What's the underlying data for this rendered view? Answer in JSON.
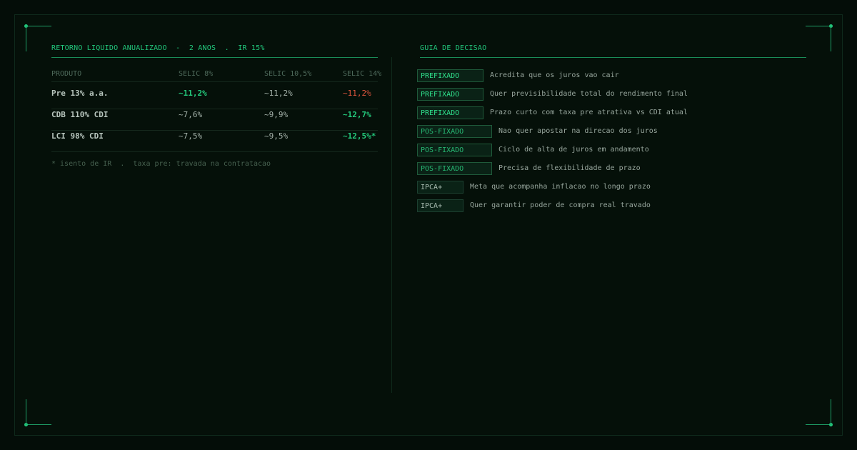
{
  "left_panel": {
    "title": "RETORNO LIQUIDO ANUALIZADO  -  2 ANOS  .  IR 15%",
    "columns": [
      "PRODUTO",
      "SELIC 8%",
      "SELIC 10,5%",
      "SELIC 14%"
    ],
    "rows": [
      {
        "product": "Pre 13% a.a.",
        "values": [
          "~11,2%",
          "~11,2%",
          "~11,2%"
        ],
        "status": [
          "best",
          "neutral",
          "worst"
        ]
      },
      {
        "product": "CDB 110% CDI",
        "values": [
          "~7,6%",
          "~9,9%",
          "~12,7%"
        ],
        "status": [
          "neutral",
          "neutral",
          "best"
        ]
      },
      {
        "product": "LCI 98% CDI",
        "values": [
          "~7,5%",
          "~9,5%",
          "~12,5%*"
        ],
        "status": [
          "neutral",
          "neutral",
          "best"
        ]
      }
    ],
    "footnote": "* isento de IR  .  taxa pre: travada na contratacao"
  },
  "right_panel": {
    "title": "GUIA DE DECISAO",
    "items": [
      {
        "tag": "PREFIXADO",
        "kind": "pre",
        "text": "Acredita que os juros vao cair"
      },
      {
        "tag": "PREFIXADO",
        "kind": "pre",
        "text": "Quer previsibilidade total do rendimento final"
      },
      {
        "tag": "PREFIXADO",
        "kind": "pre",
        "text": "Prazo curto com taxa pre atrativa vs CDI atual"
      },
      {
        "tag": "POS-FIXADO",
        "kind": "pos",
        "text": "Nao quer apostar na direcao dos juros"
      },
      {
        "tag": "POS-FIXADO",
        "kind": "pos",
        "text": "Ciclo de alta de juros em andamento"
      },
      {
        "tag": "POS-FIXADO",
        "kind": "pos",
        "text": "Precisa de flexibilidade de prazo"
      },
      {
        "tag": "IPCA+",
        "kind": "ipca",
        "text": "Meta que acompanha inflacao no longo prazo"
      },
      {
        "tag": "IPCA+",
        "kind": "ipca",
        "text": "Quer garantir poder de compra real travado"
      }
    ]
  },
  "colors": {
    "accent": "#22c77c",
    "best": "#24c97c",
    "worst": "#e0563e",
    "background": "#040d08"
  }
}
